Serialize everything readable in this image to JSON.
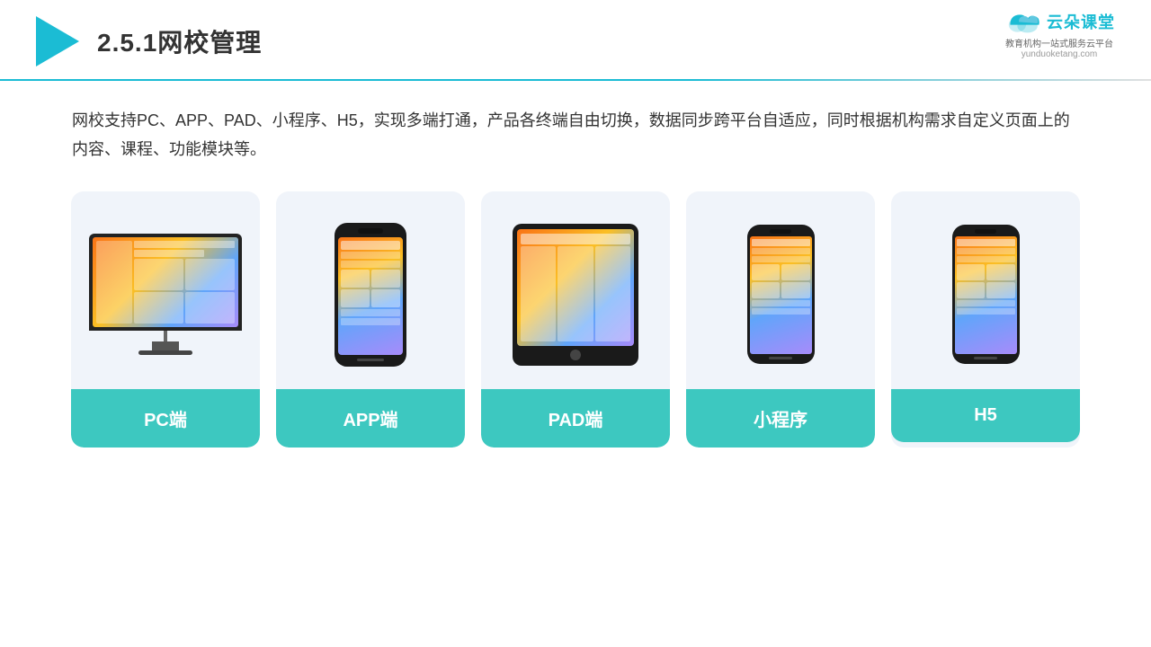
{
  "header": {
    "title": "2.5.1网校管理",
    "brand_name": "云朵课堂",
    "brand_tagline": "教育机构一站\n式服务云平台",
    "brand_url": "yunduoketang.com"
  },
  "description": {
    "text": "网校支持PC、APP、PAD、小程序、H5，实现多端打通，产品各终端自由切换，数据同步跨平台自适应，同时根据机构需求自定义页面上的内容、课程、功能模块等。"
  },
  "cards": [
    {
      "id": "pc",
      "label": "PC端"
    },
    {
      "id": "app",
      "label": "APP端"
    },
    {
      "id": "pad",
      "label": "PAD端"
    },
    {
      "id": "mini-program",
      "label": "小程序"
    },
    {
      "id": "h5",
      "label": "H5"
    }
  ]
}
